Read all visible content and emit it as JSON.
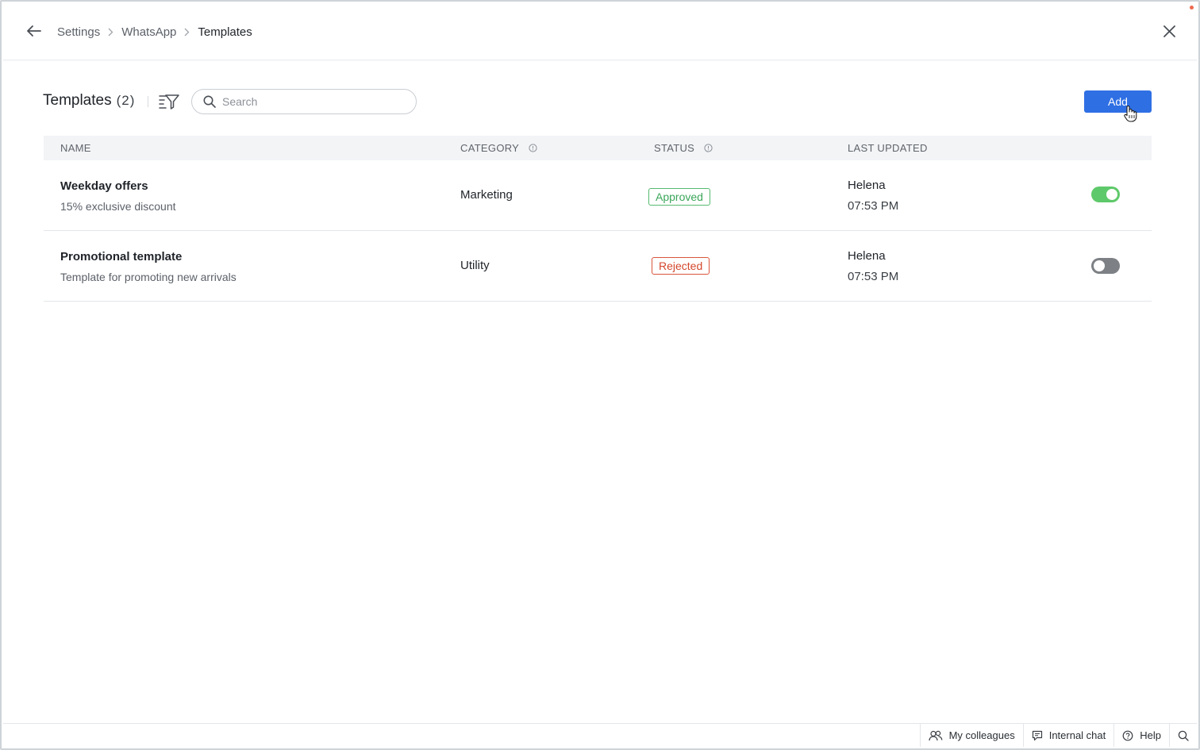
{
  "header": {
    "breadcrumb": [
      {
        "label": "Settings"
      },
      {
        "label": "WhatsApp"
      },
      {
        "label": "Templates"
      }
    ]
  },
  "toolbar": {
    "title": "Templates",
    "count": "(2)",
    "search_placeholder": "Search",
    "search_value": "",
    "add_label": "Add",
    "accent_color": "#2f6fe4"
  },
  "table": {
    "columns": {
      "name": "NAME",
      "category": "CATEGORY",
      "status": "STATUS",
      "last_updated": "LAST UPDATED"
    },
    "rows": [
      {
        "name": "Weekday offers",
        "description": "15% exclusive discount",
        "category": "Marketing",
        "status": "Approved",
        "status_color": "#3aa75a",
        "updated_by": "Helena",
        "updated_time": "07:53 PM",
        "enabled": true
      },
      {
        "name": "Promotional template",
        "description": "Template for promoting new arrivals",
        "category": "Utility",
        "status": "Rejected",
        "status_color": "#d4472c",
        "updated_by": "Helena",
        "updated_time": "07:53 PM",
        "enabled": false
      }
    ]
  },
  "footer": {
    "colleagues": "My colleagues",
    "internal_chat": "Internal chat",
    "help": "Help"
  }
}
